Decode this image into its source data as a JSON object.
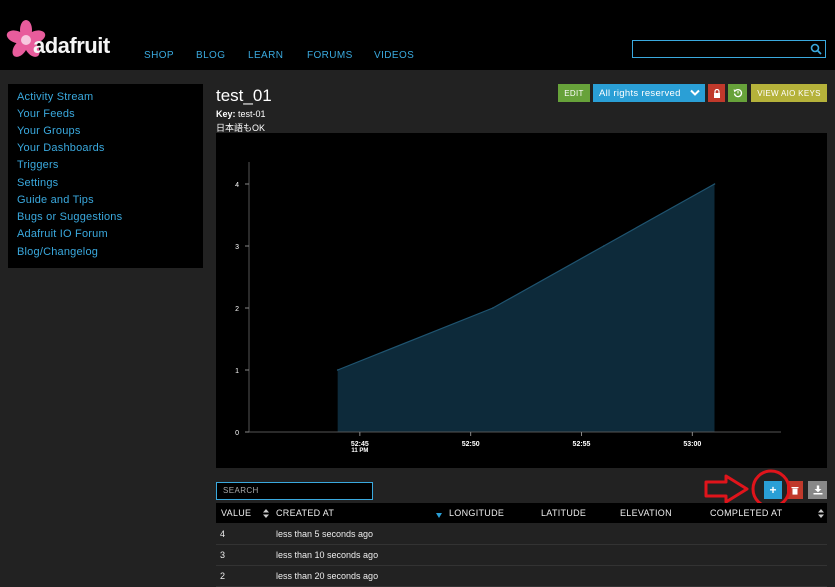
{
  "header": {
    "brand": "adafruit",
    "nav": [
      "SHOP",
      "BLOG",
      "LEARN",
      "FORUMS",
      "VIDEOS"
    ],
    "search_placeholder": ""
  },
  "sidebar": {
    "items": [
      "Activity Stream",
      "Your Feeds",
      "Your Groups",
      "Your Dashboards",
      "Triggers",
      "Settings",
      "Guide and Tips",
      "Bugs or Suggestions",
      "Adafruit IO Forum",
      "Blog/Changelog"
    ]
  },
  "feed": {
    "title": "test_01",
    "key_label": "Key:",
    "key_value": "test-01",
    "note": "日本語もOK"
  },
  "toolbar": {
    "edit": "EDIT",
    "rights": "All rights reserved",
    "view_keys": "VIEW AIO KEYS"
  },
  "chart_data": {
    "type": "area",
    "x": [
      "52:45",
      "52:50",
      "52:55",
      "53:00"
    ],
    "x_sublabel": "11 PM",
    "points": [
      {
        "t": "52:44",
        "value": 1
      },
      {
        "t": "52:51",
        "value": 2
      },
      {
        "t": "52:56",
        "value": 3
      },
      {
        "t": "53:01",
        "value": 4
      }
    ],
    "yticks": [
      0,
      1,
      2,
      3,
      4
    ],
    "ylim": [
      0,
      4
    ],
    "colors": {
      "fill": "#0d2a3a",
      "line": "#1f5470",
      "axis": "#ffffff"
    }
  },
  "table": {
    "search_placeholder": "SEARCH",
    "columns": [
      "VALUE",
      "CREATED AT",
      "LONGITUDE",
      "LATITUDE",
      "ELEVATION",
      "COMPLETED AT"
    ],
    "rows": [
      {
        "value": "4",
        "created_at": "less than 5 seconds ago"
      },
      {
        "value": "3",
        "created_at": "less than 10 seconds ago"
      },
      {
        "value": "2",
        "created_at": "less than 20 seconds ago"
      }
    ]
  },
  "colors": {
    "accent": "#3aa9de",
    "add": "#2a9fd6",
    "annotation": "#e0141b"
  }
}
